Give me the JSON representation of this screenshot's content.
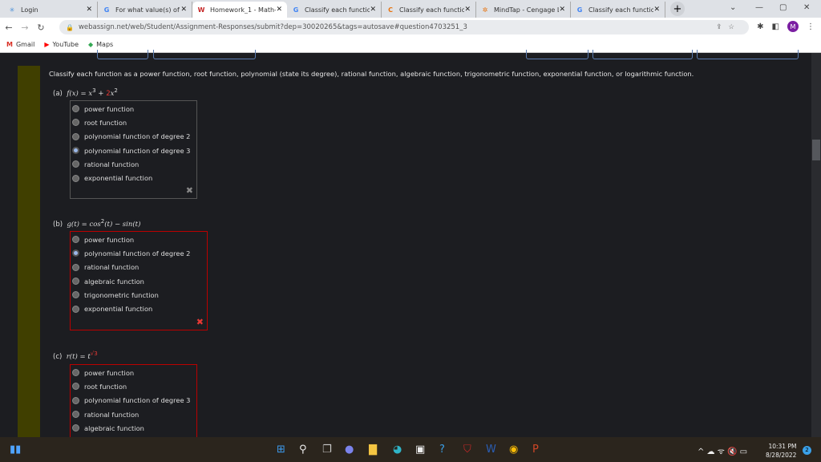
{
  "browser": {
    "tabs": [
      {
        "title": "Login",
        "icon": "login-icon",
        "active": false
      },
      {
        "title": "For what value(s) of x",
        "icon": "google-icon",
        "active": false
      },
      {
        "title": "Homework_1 - Math-",
        "icon": "webassign-icon",
        "active": true
      },
      {
        "title": "Classify each function",
        "icon": "google-icon",
        "active": false
      },
      {
        "title": "Classify each function",
        "icon": "chegg-icon",
        "active": false
      },
      {
        "title": "MindTap - Cengage L",
        "icon": "mindtap-icon",
        "active": false
      },
      {
        "title": "Classify each function",
        "icon": "google-icon",
        "active": false
      }
    ],
    "url": "webassign.net/web/Student/Assignment-Responses/submit?dep=30020265&tags=autosave#question4703251_3",
    "profile_initial": "M",
    "bookmarks": [
      "Gmail",
      "YouTube",
      "Maps"
    ]
  },
  "question": {
    "prompt": "Classify each function as a power function, root function, polynomial (state its degree), rational function, algebraic function, trigonometric function, exponential function, or logarithmic function.",
    "parts": [
      {
        "label": "(a)",
        "lhs": "f(x) = x",
        "exp1": "3",
        "mid": " + ",
        "coef": "2",
        "var": "x",
        "exp2": "2",
        "options": [
          "power function",
          "root function",
          "polynomial function of degree 2",
          "polynomial function of degree 3",
          "rational function",
          "exponential function"
        ],
        "selected": 3,
        "status": "incorrect-gray"
      },
      {
        "label": "(b)",
        "expr_a": "g(t) = cos",
        "exp": "2",
        "expr_b": "(t) − sin(t)",
        "options": [
          "power function",
          "polynomial function of degree 2",
          "rational function",
          "algebraic function",
          "trigonometric function",
          "exponential function"
        ],
        "selected": 1,
        "status": "incorrect"
      },
      {
        "label": "(c)",
        "expr": "r(t) = t",
        "exp": "√3",
        "options": [
          "power function",
          "root function",
          "polynomial function of degree 3",
          "rational function",
          "algebraic function"
        ],
        "selected": -1
      }
    ]
  },
  "taskbar": {
    "time": "10:31 PM",
    "date": "8/28/2022",
    "notifications": "2"
  },
  "colors": {
    "error": "#e53935",
    "accent": "#9bb8ea",
    "stripe": "#403f00"
  }
}
